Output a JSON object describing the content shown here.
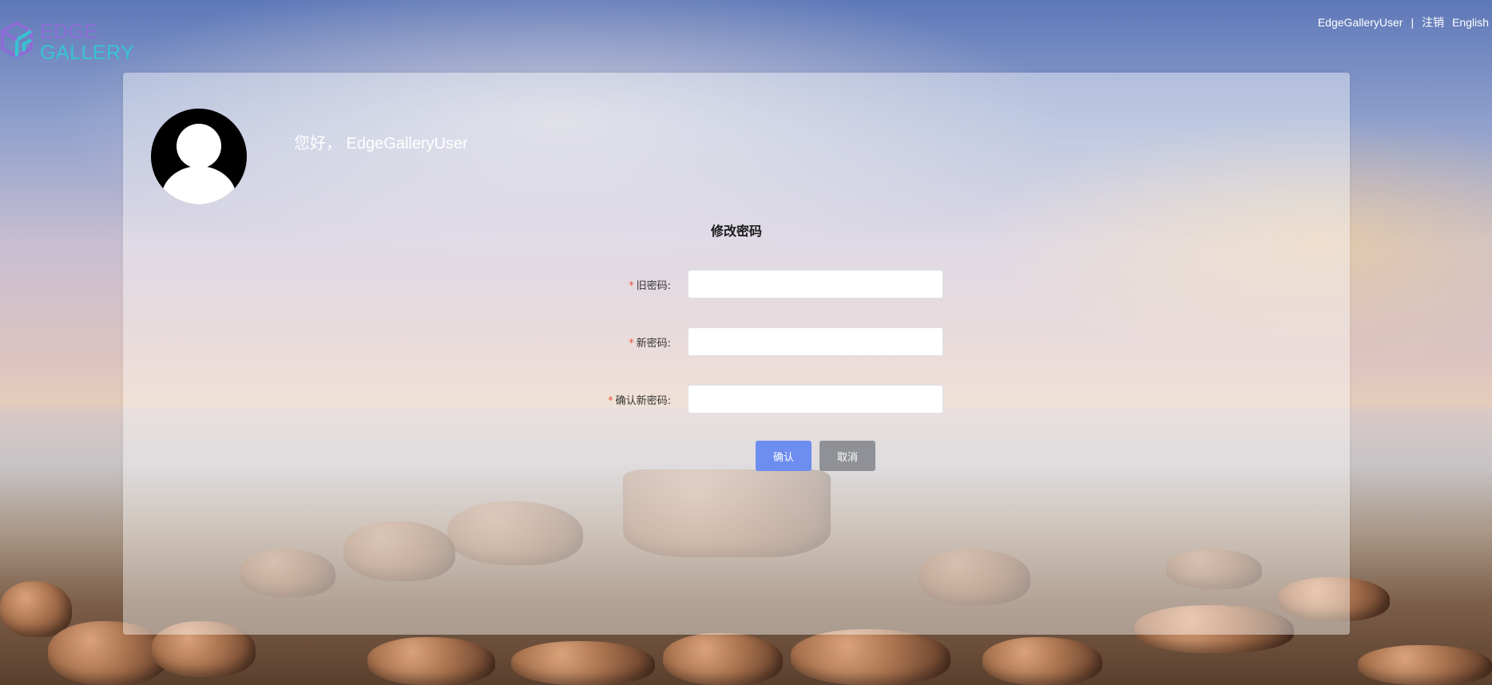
{
  "brand": {
    "line1": "EDGE",
    "line2": "GALLERY",
    "icon": "cube-logo-icon",
    "colors": {
      "purple": "#8e6bd6",
      "cyan": "#36c4d2"
    }
  },
  "topnav": {
    "user": "EdgeGalleryUser",
    "separator": "|",
    "logout": "注销",
    "language": "English"
  },
  "profile": {
    "avatar_icon": "user-avatar-icon",
    "greeting": "您好， EdgeGalleryUser"
  },
  "form": {
    "title": "修改密码",
    "required_mark": "*",
    "fields": [
      {
        "label": "旧密码:",
        "value": ""
      },
      {
        "label": "新密码:",
        "value": ""
      },
      {
        "label": "确认新密码:",
        "value": ""
      }
    ],
    "confirm_label": "确认",
    "cancel_label": "取消"
  },
  "colors": {
    "confirm": "#6e8df0",
    "cancel": "#8f9196",
    "required": "#e8553b"
  }
}
